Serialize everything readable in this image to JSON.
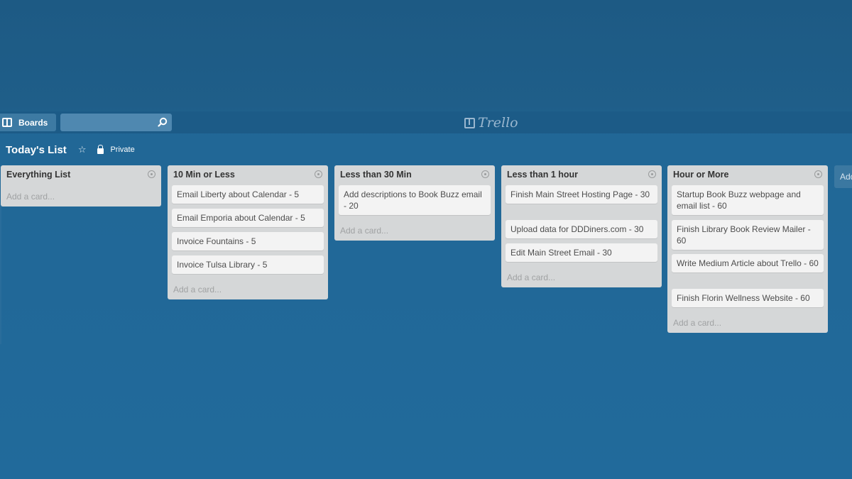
{
  "header": {
    "boards_label": "Boards",
    "logo_text": "Trello"
  },
  "board": {
    "title": "Today's List",
    "visibility": "Private"
  },
  "lists": [
    {
      "title": "Everything List",
      "cards": [],
      "add_card": "Add a card..."
    },
    {
      "title": "10 Min or Less",
      "cards": [
        "Email Liberty about Calendar - 5",
        "Email Emporia about Calendar - 5",
        "Invoice Fountains - 5",
        "Invoice Tulsa Library - 5"
      ],
      "add_card": "Add a card..."
    },
    {
      "title": "Less than 30 Min",
      "cards": [
        "Add descriptions to Book Buzz email - 20"
      ],
      "add_card": "Add a card..."
    },
    {
      "title": "Less than 1 hour",
      "cards": [
        "Finish Main Street Hosting Page - 30",
        "Upload data for DDDiners.com - 30",
        "Edit Main Street Email - 30"
      ],
      "add_card": "Add a card..."
    },
    {
      "title": "Hour or More",
      "cards": [
        "Startup Book Buzz webpage and email list - 60",
        "Finish Library Book Review Mailer - 60",
        "Write Medium Article about Trello - 60",
        "Finish Florin Wellness Website - 60"
      ],
      "add_card": "Add a card..."
    }
  ],
  "add_list_label": "Add",
  "colors": {
    "background": "#216a9b",
    "list": "#d5d7d8",
    "card": "#f3f3f3"
  }
}
